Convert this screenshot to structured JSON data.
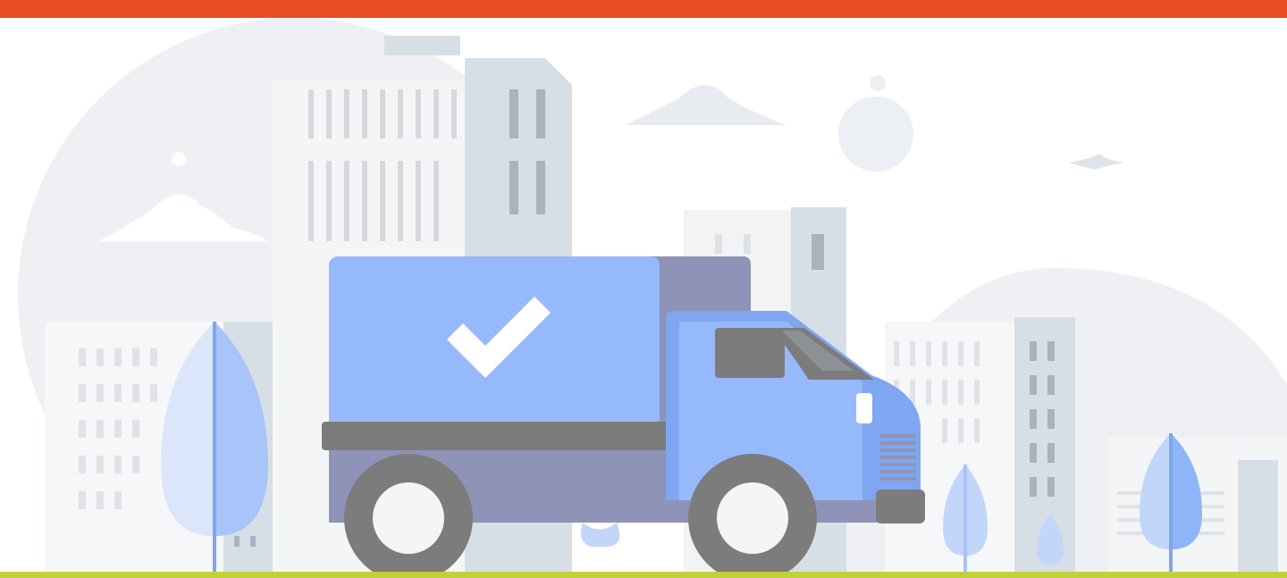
{
  "colors": {
    "top_bar": "#e84c22",
    "bottom_bar": "#c2d13a",
    "background": "#ffffff",
    "buildings_light": "#eef0f4",
    "buildings_mid": "#d7dfe6",
    "window": "#b7c3cc",
    "truck_box": "#96b9fb",
    "truck_cab": "#7fa6f0",
    "truck_shadow": "#8f93b8",
    "truck_dark": "#7c7c7c",
    "tree_light": "#dbe6fb",
    "tree_mid": "#a8c4f8",
    "checkmark": "#ffffff"
  },
  "icons": {
    "hero": "delivery-truck-icon",
    "badge": "checkmark-icon"
  }
}
